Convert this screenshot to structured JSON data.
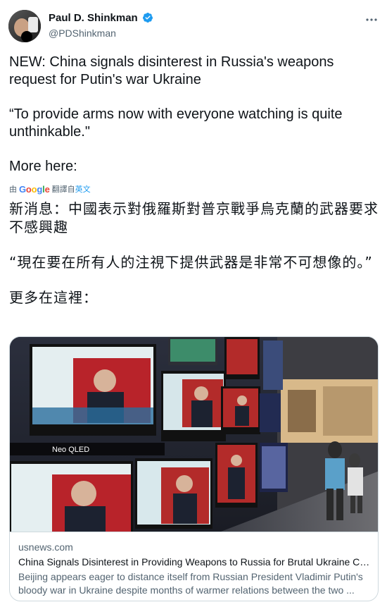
{
  "author": {
    "display_name": "Paul D. Shinkman",
    "handle": "@PDShinkman",
    "verified": true
  },
  "tweet": {
    "paragraph_1": "NEW: China signals disinterest in Russia's weapons request for Putin's war Ukraine",
    "paragraph_2": "“To provide arms now with everyone watching is quite unthinkable.\"",
    "paragraph_3": "More here:"
  },
  "translation": {
    "prefix": "由",
    "provider": "Google",
    "action": "翻譯自",
    "source_language": "英文"
  },
  "translated": {
    "paragraph_1": "新消息：中國表示對俄羅斯對普京戰爭烏克蘭的武器要求不感興趣",
    "paragraph_2": "“現在要在所有人的注視下提供武器是非常不可想像的。”",
    "paragraph_3": "更多在這裡："
  },
  "card": {
    "domain": "usnews.com",
    "title": "China Signals Disinterest in Providing Weapons to Russia for Brutal Ukraine Ca...",
    "description": "Beijing appears eager to distance itself from Russian President Vladimir Putin's bloody war in Ukraine despite months of warmer relations between the two ...",
    "image_brand_text": "Neo QLED"
  },
  "icons": {
    "more": "more-horizontal-icon",
    "verified": "verified-badge-icon"
  },
  "colors": {
    "accent": "#1d9bf0",
    "text": "#0f1419",
    "secondary": "#536471",
    "border": "#cfd9de"
  }
}
